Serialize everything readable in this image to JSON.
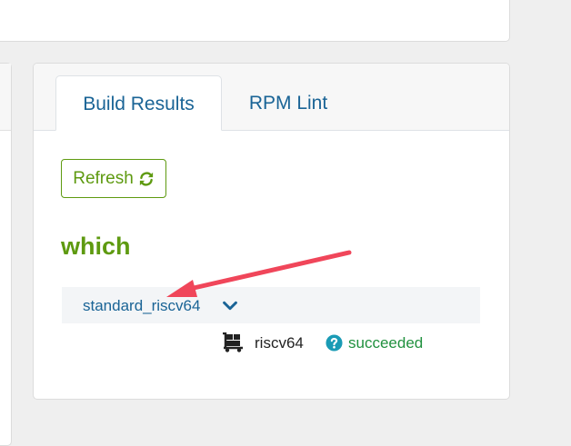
{
  "tabs": [
    {
      "label": "Build Results",
      "active": true
    },
    {
      "label": "RPM Lint",
      "active": false
    }
  ],
  "refresh": {
    "label": "Refresh",
    "icon": "refresh-icon"
  },
  "package": {
    "name": "which"
  },
  "repository": {
    "name": "standard_riscv64",
    "icon": "chevron-down-icon"
  },
  "build": {
    "arch": "riscv64",
    "arch_icon": "dolly-icon",
    "status": "succeeded",
    "status_icon": "question-circle-icon"
  },
  "colors": {
    "accent_green": "#5e9a10",
    "link_blue": "#1a6496",
    "status_green": "#21913f",
    "status_icon_blue": "#1a9bb5",
    "annotation_arrow": "#f0465a"
  }
}
